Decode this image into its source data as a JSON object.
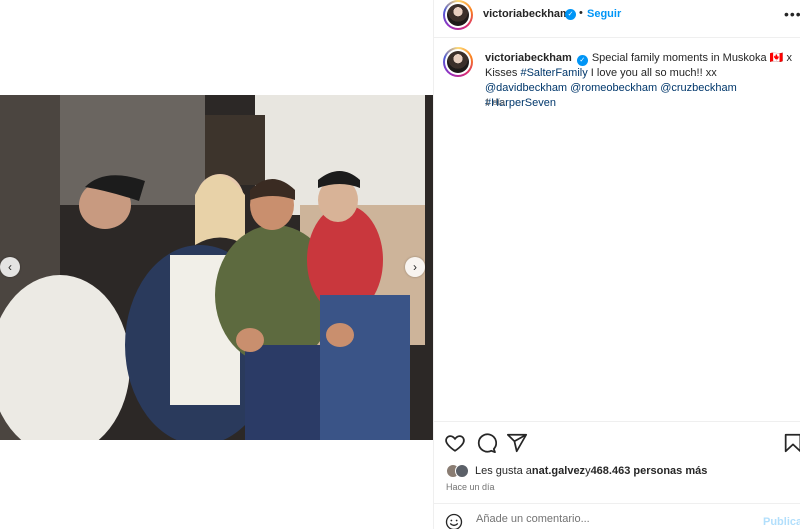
{
  "post": {
    "username": "victoriabeckham",
    "verified_mark": "✓",
    "separator": "•",
    "follow_label": "Seguir",
    "more_icon": "more-horizontal-icon"
  },
  "caption": {
    "username": "victoriabeckham",
    "text_before": "Special family moments in Muskoka 🇨🇦 x Kisses ",
    "tag_salter": "#SalterFamily",
    "text_middle": " I love you all so much!! xx ",
    "tag_david": "@davidbeckham",
    "tag_romeo": "@romeobeckham",
    "tag_cruz": "@cruzbeckham",
    "tag_harper": "#HarperSeven",
    "time": "1 día"
  },
  "photo": {
    "prev_icon": "‹",
    "next_icon": "›"
  },
  "actions": {
    "like_icon": "heart-icon",
    "comment_icon": "comment-icon",
    "share_icon": "share-icon",
    "save_icon": "bookmark-icon"
  },
  "likes": {
    "prefix": "Les gusta a ",
    "user": "nat.galvez",
    "connector": " y ",
    "count_text": "468.463 personas más"
  },
  "post_time": "Hace un día",
  "comment": {
    "placeholder": "Añade un comentario...",
    "publish_label": "Publicar"
  },
  "colors": {
    "accent": "#0095f6",
    "link": "#00376b",
    "muted": "#737373",
    "publish_disabled": "#b2dffc"
  }
}
